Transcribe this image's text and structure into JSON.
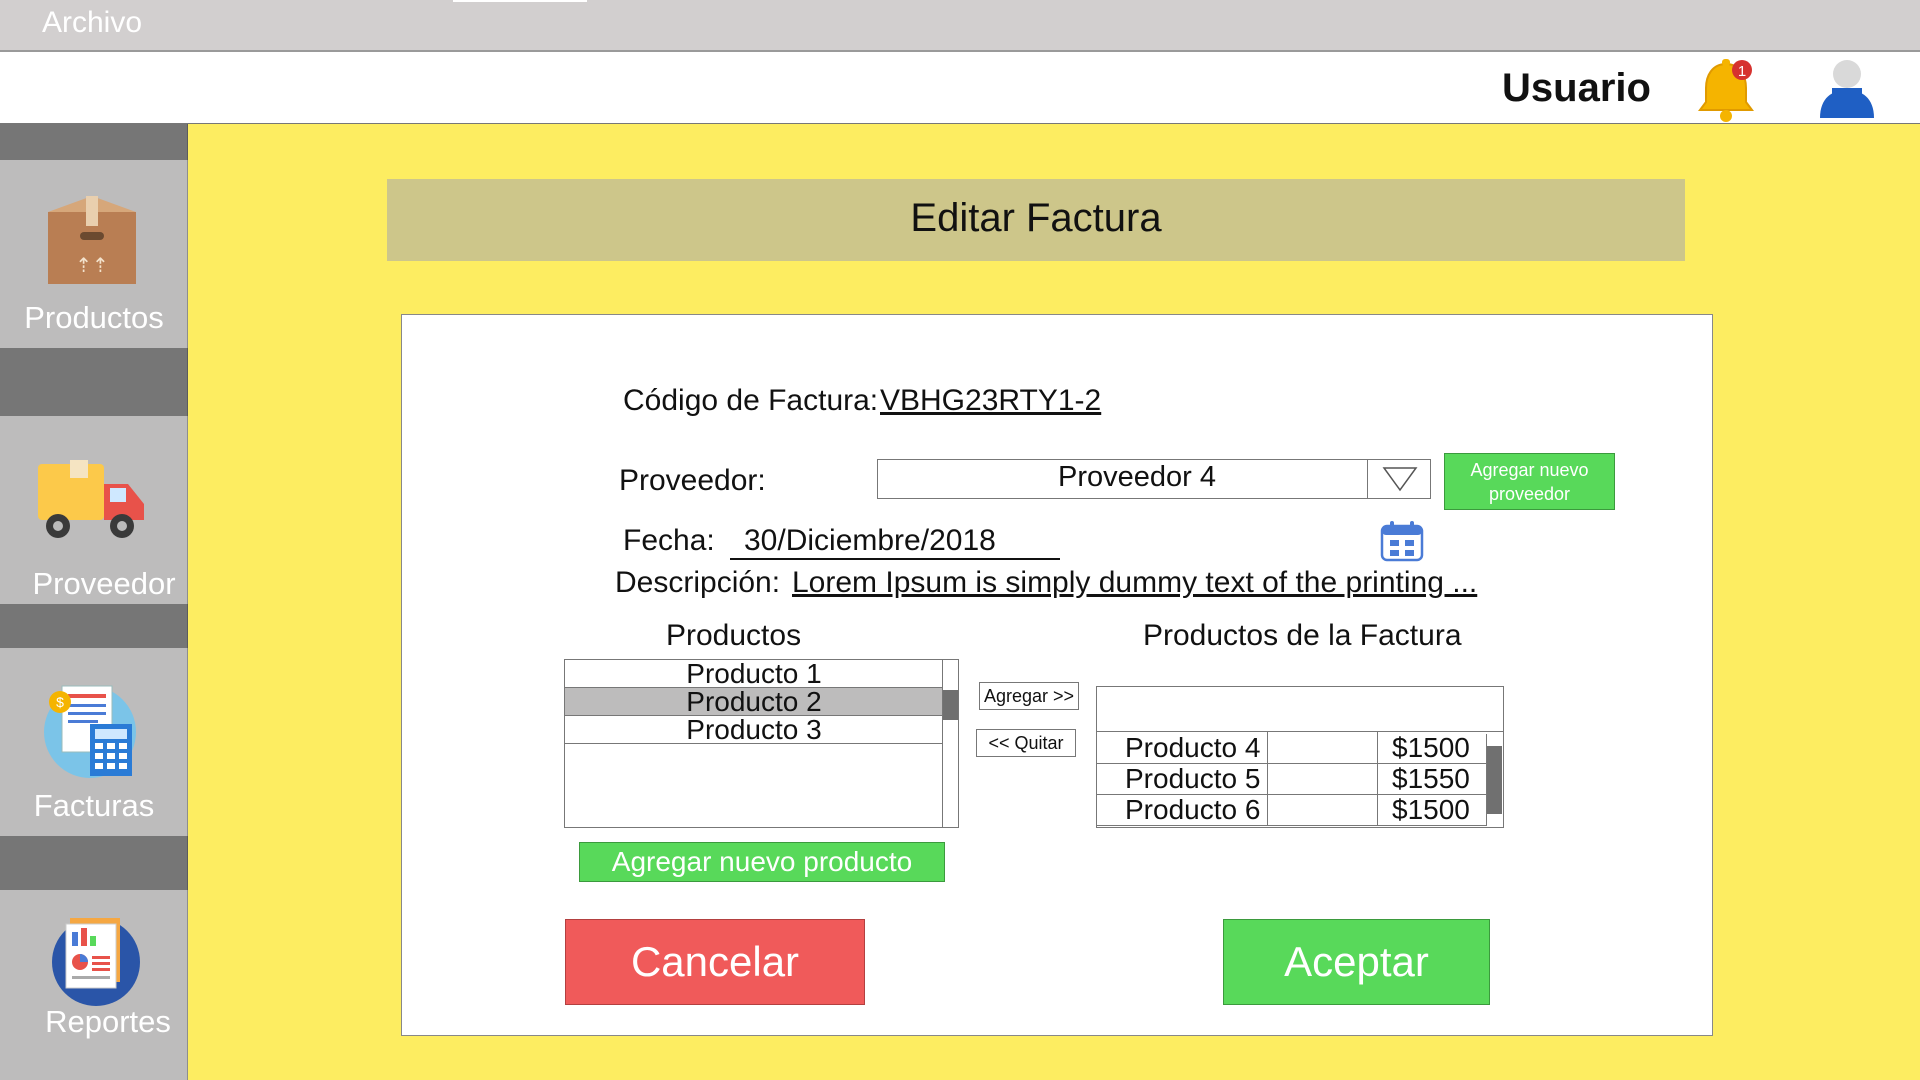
{
  "menubar": {
    "archivo": "Archivo"
  },
  "header": {
    "user_label": "Usuario",
    "notification_count": "1"
  },
  "sidebar": {
    "items": [
      {
        "label": "Productos",
        "icon": "box-icon"
      },
      {
        "label": "Proveedor",
        "icon": "truck-icon"
      },
      {
        "label": "Facturas",
        "icon": "invoice-calculator-icon"
      },
      {
        "label": "Reportes",
        "icon": "report-icon"
      }
    ]
  },
  "page": {
    "title": "Editar Factura"
  },
  "form": {
    "codigo_label": "Código de Factura:",
    "codigo_value": "VBHG23RTY1-2",
    "proveedor_label": "Proveedor:",
    "proveedor_value": "Proveedor 4",
    "agregar_proveedor_line1": "Agregar nuevo",
    "agregar_proveedor_line2": "proveedor",
    "fecha_label": "Fecha:",
    "fecha_value": "30/Diciembre/2018",
    "descripcion_label": "Descripción:",
    "descripcion_value": "Lorem Ipsum is simply dummy text of the printing ..."
  },
  "productos": {
    "heading": "Productos",
    "items": [
      "Producto 1",
      "Producto 2",
      "Producto 3"
    ],
    "selected_index": 1,
    "add_new_label": "Agregar nuevo producto"
  },
  "transfer": {
    "agregar_label": "Agregar >>",
    "quitar_label": "<< Quitar"
  },
  "factura_productos": {
    "heading": "Productos de la Factura",
    "rows": [
      {
        "name": "Producto 4",
        "price": "$1500"
      },
      {
        "name": "Producto 5",
        "price": "$1550"
      },
      {
        "name": "Producto 6",
        "price": "$1500"
      }
    ]
  },
  "actions": {
    "cancelar": "Cancelar",
    "aceptar": "Aceptar"
  },
  "colors": {
    "background": "#fded61",
    "title_bar": "#cdc68a",
    "sidebar": "#767676",
    "sidebar_item": "#bdbcbc",
    "green": "#58d95a",
    "red": "#f05a5a"
  }
}
